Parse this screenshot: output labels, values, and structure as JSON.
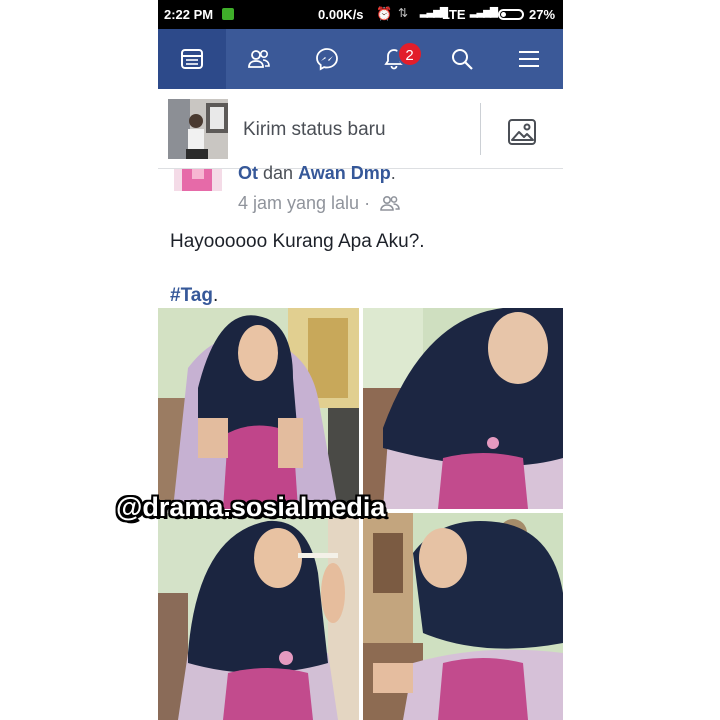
{
  "status_bar": {
    "time": "2:22 PM",
    "network_speed": "0.00K/s",
    "network_type": "LTE",
    "battery_percent": "27%",
    "battery_level": 0.27
  },
  "nav": {
    "tabs": [
      {
        "name": "news-feed",
        "icon": "newsfeed-icon",
        "active": true
      },
      {
        "name": "friend-requests",
        "icon": "friends-icon",
        "active": false
      },
      {
        "name": "messenger",
        "icon": "messenger-icon",
        "active": false
      },
      {
        "name": "notifications",
        "icon": "bell-icon",
        "active": false,
        "badge": "2"
      },
      {
        "name": "search",
        "icon": "search-icon",
        "active": false
      },
      {
        "name": "menu",
        "icon": "hamburger-icon",
        "active": false
      }
    ],
    "notification_badge": "2",
    "bar_color": "#3b5998",
    "badge_color": "#e21e2a"
  },
  "composer": {
    "placeholder": "Kirim status baru",
    "photo_button_icon": "photo-icon"
  },
  "post": {
    "author_fragment": "Ot",
    "connector": "dan",
    "tagged_name": "Awan Dmp",
    "timestamp": "4 jam yang lalu",
    "separator": "·",
    "privacy_icon": "friends-icon",
    "message": "Hayoooooo Kurang Apa Aku?.",
    "hashtag": "#Tag",
    "hashtag_suffix": ".",
    "link_color": "#365899"
  },
  "watermark": "@drama.sosialmedia"
}
